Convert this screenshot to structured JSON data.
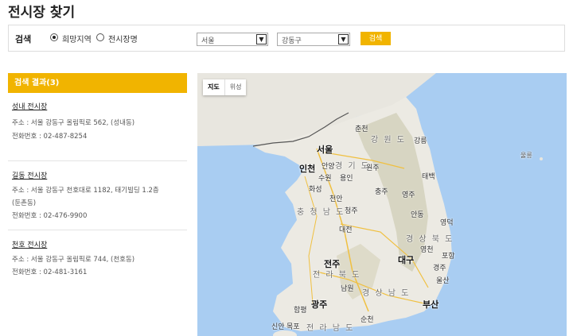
{
  "page": {
    "title": "전시장 찾기"
  },
  "search": {
    "label": "검색",
    "options": [
      {
        "label": "희망지역",
        "selected": true
      },
      {
        "label": "전시장명",
        "selected": false
      }
    ],
    "city_select": "서울",
    "district_select": "강동구",
    "button_label": "검색"
  },
  "results": {
    "header": "검색 결과(3)",
    "items": [
      {
        "name": "성내 전시장",
        "address": "주소 : 서울 강동구 올림픽로 562, (성내동)",
        "phone": "전화번호 : 02-487-8254"
      },
      {
        "name": "길동 전시장",
        "address": "주소 : 서울 강동구 천호대로 1182, 태기빌딩 1.2층",
        "address2": "(둔촌동)",
        "phone": "전화번호 : 02-476-9900"
      },
      {
        "name": "천호 전시장",
        "address": "주소 : 서울 강동구 올림픽로 744, (천호동)",
        "phone": "전화번호 : 02-481-3161"
      }
    ]
  },
  "map": {
    "type_buttons": [
      "지도",
      "위성"
    ],
    "labels": {
      "chuncheon": "춘천",
      "gangwon": "강 원 도",
      "gangneung": "강릉",
      "ulleung": "울릉",
      "seoul": "서울",
      "incheon": "인천",
      "anyang": "안양",
      "suwon": "수원",
      "yongin": "용인",
      "gyeonggi": "경 기 도",
      "wonju": "원주",
      "taebaek": "태백",
      "hwaseong": "화성",
      "cheonan": "천안",
      "chungju": "충주",
      "yeongju": "영주",
      "chungnam": "충 청 남 도",
      "cheongju": "청주",
      "andong": "안동",
      "yeongdeok": "영덕",
      "daejeon": "대전",
      "gyeongbuk": "경 상 북 도",
      "jeonju": "전주",
      "daegu": "대구",
      "yeongcheon": "영천",
      "pohang": "포항",
      "gyeongju": "경주",
      "jeonbuk": "전 라 북 도",
      "namwon": "남원",
      "ulsan": "울산",
      "gyeongnam": "경 상 남 도",
      "gwangju": "광주",
      "busan": "부산",
      "hampyeong": "함평",
      "mokpo": "목포",
      "sinan": "신안",
      "jeonnam": "전 라 남 도",
      "suncheon": "순천"
    }
  }
}
